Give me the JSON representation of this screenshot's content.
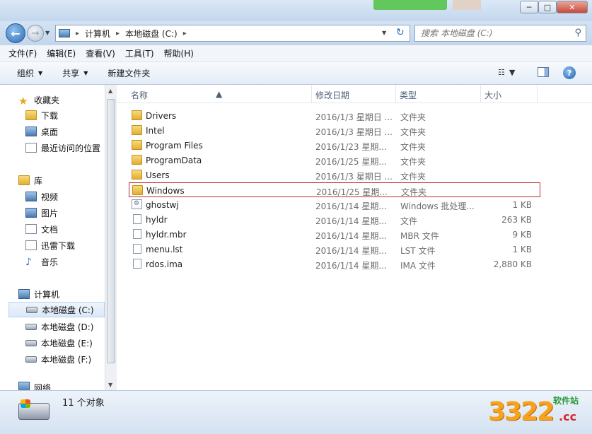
{
  "window": {
    "minimize": "─",
    "maximize": "□",
    "close": "✕"
  },
  "address": {
    "crumbs": [
      "计算机",
      "本地磁盘 (C:)"
    ],
    "separator": "▸"
  },
  "search": {
    "placeholder": "搜索 本地磁盘 (C:)"
  },
  "menu": [
    "文件(F)",
    "编辑(E)",
    "查看(V)",
    "工具(T)",
    "帮助(H)"
  ],
  "toolbar": {
    "organize": "组织",
    "share": "共享",
    "new_folder": "新建文件夹"
  },
  "nav": {
    "favorites": "收藏夹",
    "downloads": "下载",
    "desktop": "桌面",
    "recent": "最近访问的位置",
    "libraries": "库",
    "videos": "视频",
    "pictures": "图片",
    "documents": "文档",
    "thunder": "迅雷下载",
    "music": "音乐",
    "computer": "计算机",
    "drive_c": "本地磁盘 (C:)",
    "drive_d": "本地磁盘 (D:)",
    "drive_e": "本地磁盘 (E:)",
    "drive_f": "本地磁盘 (F:)",
    "network": "网络"
  },
  "columns": {
    "name": "名称",
    "date": "修改日期",
    "type": "类型",
    "size": "大小"
  },
  "files": [
    {
      "name": "Drivers",
      "date": "2016/1/3 星期日 ...",
      "type": "文件夹",
      "size": "",
      "kind": "folder"
    },
    {
      "name": "Intel",
      "date": "2016/1/3 星期日 ...",
      "type": "文件夹",
      "size": "",
      "kind": "folder"
    },
    {
      "name": "Program Files",
      "date": "2016/1/23 星期...",
      "type": "文件夹",
      "size": "",
      "kind": "folder"
    },
    {
      "name": "ProgramData",
      "date": "2016/1/25 星期...",
      "type": "文件夹",
      "size": "",
      "kind": "folder"
    },
    {
      "name": "Users",
      "date": "2016/1/3 星期日 ...",
      "type": "文件夹",
      "size": "",
      "kind": "folder"
    },
    {
      "name": "Windows",
      "date": "2016/1/25 星期...",
      "type": "文件夹",
      "size": "",
      "kind": "folder"
    },
    {
      "name": "ghostwj",
      "date": "2016/1/14 星期...",
      "type": "Windows 批处理...",
      "size": "1 KB",
      "kind": "bat"
    },
    {
      "name": "hyldr",
      "date": "2016/1/14 星期...",
      "type": "文件",
      "size": "263 KB",
      "kind": "file"
    },
    {
      "name": "hyldr.mbr",
      "date": "2016/1/14 星期...",
      "type": "MBR 文件",
      "size": "9 KB",
      "kind": "file"
    },
    {
      "name": "menu.lst",
      "date": "2016/1/14 星期...",
      "type": "LST 文件",
      "size": "1 KB",
      "kind": "file"
    },
    {
      "name": "rdos.ima",
      "date": "2016/1/14 星期...",
      "type": "IMA 文件",
      "size": "2,880 KB",
      "kind": "file"
    }
  ],
  "status": {
    "count": "11 个对象"
  },
  "watermark": {
    "number": "3322",
    "site": "软件站",
    "tld": ".cc"
  }
}
